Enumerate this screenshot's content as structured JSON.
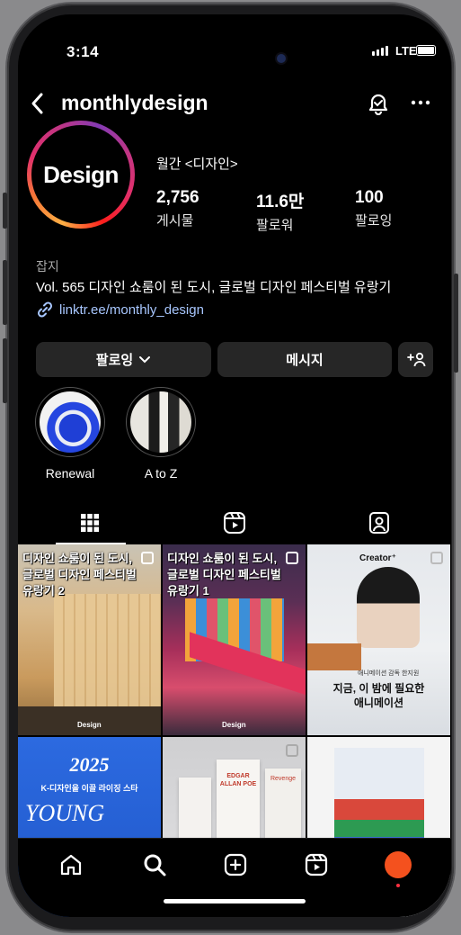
{
  "status": {
    "time": "3:14",
    "network": "LTE"
  },
  "header": {
    "username": "monthlydesign",
    "back_icon": "chevron-left-icon",
    "bell_icon": "notification-bell-icon",
    "more_icon": "more-horizontal-icon"
  },
  "profile": {
    "avatar_text": "Design",
    "full_name": "월간 <디자인>",
    "stats": [
      {
        "value": "2,756",
        "label": "게시물"
      },
      {
        "value": "11.6만",
        "label": "팔로워"
      },
      {
        "value": "100",
        "label": "팔로잉"
      }
    ],
    "category": "잡지",
    "bio": "Vol. 565 디자인 쇼룸이 된 도시, 글로벌 디자인 페스티벌 유랑기",
    "link": "linktr.ee/monthly_design"
  },
  "actions": {
    "following_label": "팔로잉",
    "message_label": "메시지"
  },
  "highlights": [
    {
      "label": "Renewal"
    },
    {
      "label": "A to Z"
    }
  ],
  "tabs": [
    "grid-icon",
    "reels-icon",
    "tagged-icon"
  ],
  "posts": [
    {
      "caption_line1": "디자인 쇼룸이 된 도시,",
      "caption_line2": "글로벌 디자인 페스티벌",
      "caption_line3": "유랑기 2",
      "footer": "Design"
    },
    {
      "caption_line1": "디자인 쇼룸이 된 도시,",
      "caption_line2": "글로벌 디자인 페스티벌",
      "caption_line3": "유랑기 1",
      "footer": "Design"
    },
    {
      "badge": "Creator⁺",
      "caption_small": "애니메이션 감독 한지원",
      "caption_line1": "지금, 이 밤에 필요한",
      "caption_line2": "애니메이션"
    },
    {
      "year": "2025",
      "subtitle": "K-디자인을 이끌 라이징 스타",
      "word": "YOUNG"
    },
    {
      "book1": "EDGAR ALLAN POE",
      "book2": "Revenge"
    },
    {}
  ],
  "colors": {
    "background": "#000000",
    "pill": "#262626",
    "link": "#a8c7ff",
    "accent": "#f4511e"
  }
}
